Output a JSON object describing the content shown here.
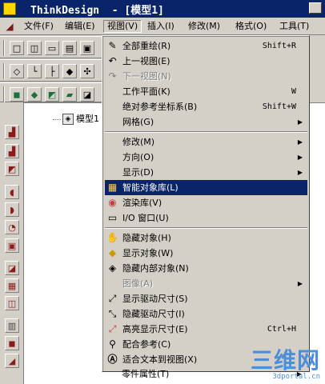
{
  "title": {
    "text": "ThinkDesign  - [模型1]"
  },
  "menubar": {
    "items": [
      "文件(F)",
      "编辑(E)",
      "视图(V)",
      "插入(I)",
      "修改(M)",
      "格式(O)",
      "工具(T)"
    ]
  },
  "tree": {
    "root_label": "模型1"
  },
  "view_menu": {
    "items": [
      {
        "label": "全部重绘(R)",
        "shortcut": "Shift+R",
        "icon": "redraw-icon"
      },
      {
        "label": "上一视图(E)",
        "shortcut": "",
        "icon": "prev-view-icon"
      },
      {
        "label": "下一视图(N)",
        "shortcut": "",
        "icon": "next-view-icon",
        "disabled": true
      },
      {
        "label": "工作平面(K)",
        "shortcut": "W"
      },
      {
        "label": "绝对参考坐标系(B)",
        "shortcut": "Shift+W"
      },
      {
        "label": "网格(G)",
        "submenu": true
      },
      {
        "label": "修改(M)",
        "submenu": true
      },
      {
        "label": "方向(O)",
        "submenu": true
      },
      {
        "label": "显示(D)",
        "submenu": true
      },
      {
        "label": "智能对象库(L)",
        "icon": "smart-library-icon",
        "highlighted": true
      },
      {
        "label": "渲染库(V)",
        "icon": "render-library-icon"
      },
      {
        "label": "I/O 窗口(U)",
        "icon": "io-window-icon"
      },
      {
        "label": "隐藏对象(H)",
        "icon": "hide-object-icon"
      },
      {
        "label": "显示对象(W)",
        "icon": "show-object-icon"
      },
      {
        "label": "隐藏内部对象(N)",
        "icon": "hide-internal-icon"
      },
      {
        "label": "图像(A)",
        "submenu": true,
        "disabled": true
      },
      {
        "label": "显示驱动尺寸(S)",
        "icon": "show-driving-dim-icon"
      },
      {
        "label": "隐藏驱动尺寸(I)",
        "icon": "hide-driving-dim-icon"
      },
      {
        "label": "高亮显示尺寸(E)",
        "shortcut": "Ctrl+H",
        "icon": "highlight-dim-icon"
      },
      {
        "label": "配合参考(C)",
        "icon": "mate-reference-icon"
      },
      {
        "label": "适合文本到视图(X)",
        "icon": "fit-text-icon"
      },
      {
        "label": "零件属性(T)",
        "submenu": true
      }
    ]
  },
  "watermark": {
    "big": "三维网",
    "small": "3dportal.cn"
  },
  "colors": {
    "title_bg": "#0a246a",
    "face": "#d4d0c8",
    "highlight": "#0a246a",
    "watermark": "#4a8fd8"
  }
}
